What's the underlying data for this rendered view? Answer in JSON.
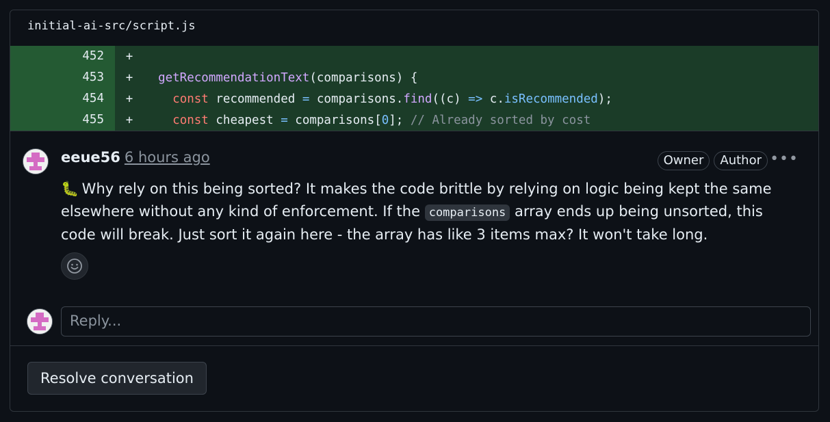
{
  "file": {
    "path": "initial-ai-src/script.js"
  },
  "diff": {
    "rows": [
      {
        "line": "452",
        "sign": "+"
      },
      {
        "line": "453",
        "sign": "+"
      },
      {
        "line": "454",
        "sign": "+"
      },
      {
        "line": "455",
        "sign": "+"
      }
    ],
    "code453": {
      "fn": "getRecommendationText",
      "rest": "(comparisons) {"
    },
    "code454": {
      "kw": "const",
      "a": " recommended ",
      "eq": "=",
      "b": " comparisons.",
      "fn": "find",
      "c": "((c) ",
      "arrow": "=>",
      "d": " c.",
      "prop": "isRecommended",
      "e": ");"
    },
    "code455": {
      "kw": "const",
      "a": " cheapest ",
      "eq": "=",
      "b": " comparisons[",
      "num": "0",
      "c": "]; ",
      "cm": "// Already sorted by cost"
    }
  },
  "comment": {
    "author": "eeue56",
    "time": "6 hours ago",
    "badges": [
      "Owner",
      "Author"
    ],
    "body_part1": " Why rely on this being sorted? It makes the code brittle by relying on logic being kept the same elsewhere without any kind of enforcement. If the ",
    "body_code": "comparisons",
    "body_part2": " array ends up being unsorted, this code will break. Just sort it again here - the array has like 3 items max? It won't take long.",
    "icon": "bug-icon"
  },
  "reply": {
    "placeholder": "Reply..."
  },
  "actions": {
    "resolve_label": "Resolve conversation"
  },
  "colors": {
    "background": "#0d1117",
    "diff_added": "#1b3c28",
    "border": "#30363d"
  }
}
